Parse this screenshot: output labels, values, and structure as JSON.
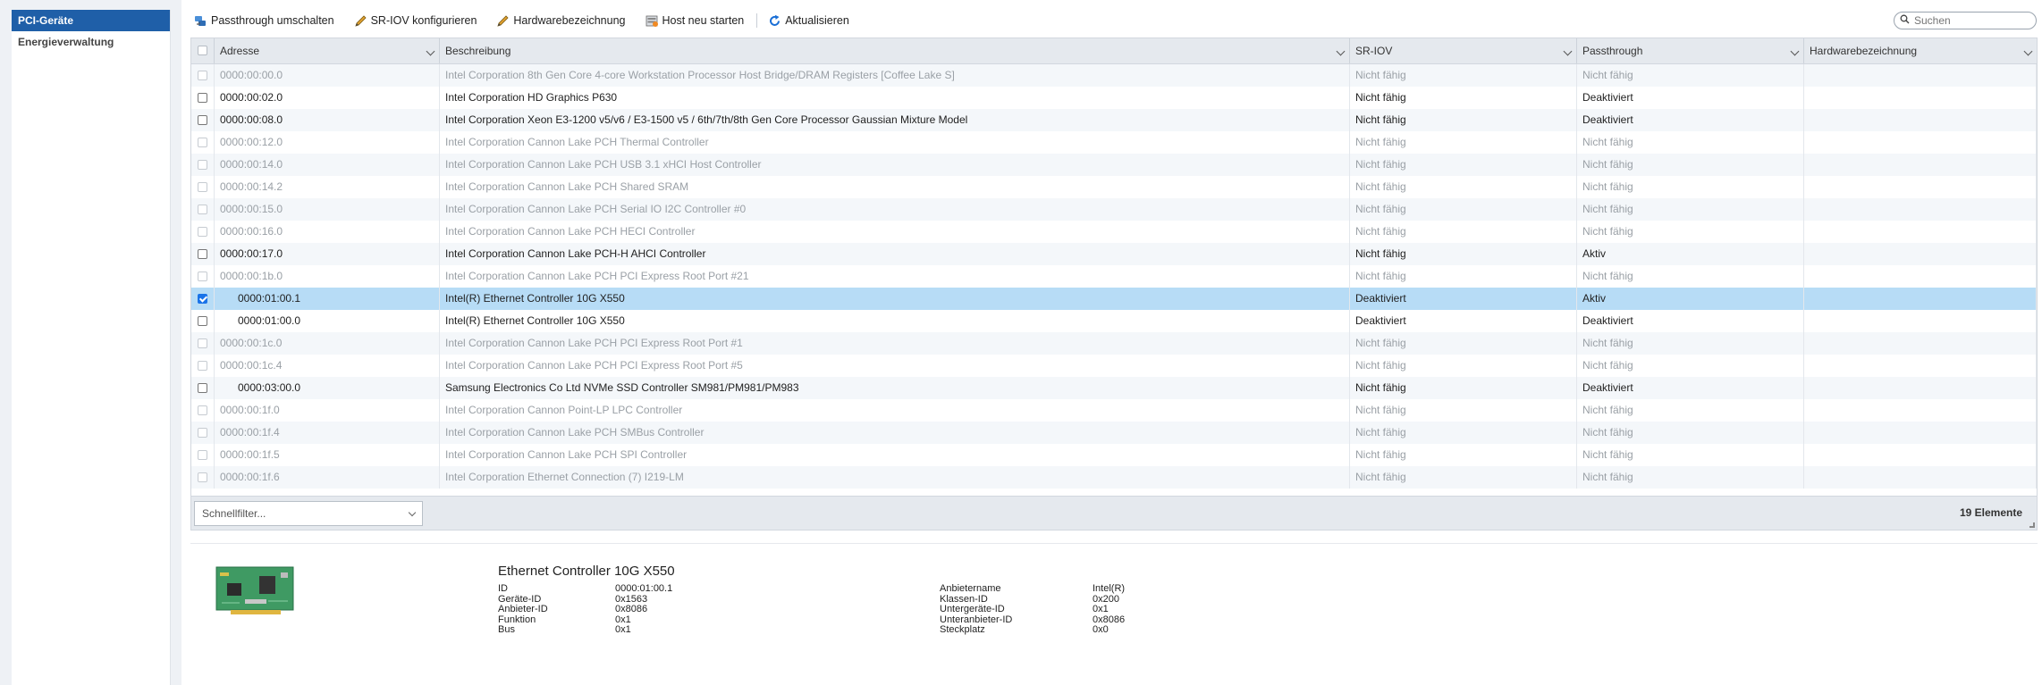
{
  "sidebar": {
    "items": [
      {
        "label": "PCI-Geräte",
        "active": true
      },
      {
        "label": "Energieverwaltung",
        "active": false
      }
    ]
  },
  "toolbar": {
    "passthrough": "Passthrough umschalten",
    "sriov": "SR-IOV konfigurieren",
    "hwlabel": "Hardwarebezeichnung",
    "restart": "Host neu starten",
    "refresh": "Aktualisieren",
    "search_placeholder": "Suchen"
  },
  "grid": {
    "columns": [
      "Adresse",
      "Beschreibung",
      "SR-IOV",
      "Passthrough",
      "Hardwarebezeichnung"
    ],
    "rows": [
      {
        "address": "0000:00:00.0",
        "description": "Intel Corporation 8th Gen Core 4-core Workstation Processor Host Bridge/DRAM Registers [Coffee Lake S]",
        "sriov": "Nicht fähig",
        "passthrough": "Nicht fähig",
        "hw": "",
        "enabled": false,
        "checked": false,
        "indent": false
      },
      {
        "address": "0000:00:02.0",
        "description": "Intel Corporation HD Graphics P630",
        "sriov": "Nicht fähig",
        "passthrough": "Deaktiviert",
        "hw": "",
        "enabled": true,
        "checked": false,
        "indent": false
      },
      {
        "address": "0000:00:08.0",
        "description": "Intel Corporation Xeon E3-1200 v5/v6 / E3-1500 v5 / 6th/7th/8th Gen Core Processor Gaussian Mixture Model",
        "sriov": "Nicht fähig",
        "passthrough": "Deaktiviert",
        "hw": "",
        "enabled": true,
        "checked": false,
        "indent": false
      },
      {
        "address": "0000:00:12.0",
        "description": "Intel Corporation Cannon Lake PCH Thermal Controller",
        "sriov": "Nicht fähig",
        "passthrough": "Nicht fähig",
        "hw": "",
        "enabled": false,
        "checked": false,
        "indent": false
      },
      {
        "address": "0000:00:14.0",
        "description": "Intel Corporation Cannon Lake PCH USB 3.1 xHCI Host Controller",
        "sriov": "Nicht fähig",
        "passthrough": "Nicht fähig",
        "hw": "",
        "enabled": false,
        "checked": false,
        "indent": false
      },
      {
        "address": "0000:00:14.2",
        "description": "Intel Corporation Cannon Lake PCH Shared SRAM",
        "sriov": "Nicht fähig",
        "passthrough": "Nicht fähig",
        "hw": "",
        "enabled": false,
        "checked": false,
        "indent": false
      },
      {
        "address": "0000:00:15.0",
        "description": "Intel Corporation Cannon Lake PCH Serial IO I2C Controller #0",
        "sriov": "Nicht fähig",
        "passthrough": "Nicht fähig",
        "hw": "",
        "enabled": false,
        "checked": false,
        "indent": false
      },
      {
        "address": "0000:00:16.0",
        "description": "Intel Corporation Cannon Lake PCH HECI Controller",
        "sriov": "Nicht fähig",
        "passthrough": "Nicht fähig",
        "hw": "",
        "enabled": false,
        "checked": false,
        "indent": false
      },
      {
        "address": "0000:00:17.0",
        "description": "Intel Corporation Cannon Lake PCH-H AHCI Controller",
        "sriov": "Nicht fähig",
        "passthrough": "Aktiv",
        "hw": "",
        "enabled": true,
        "checked": false,
        "indent": false
      },
      {
        "address": "0000:00:1b.0",
        "description": "Intel Corporation Cannon Lake PCH PCI Express Root Port #21",
        "sriov": "Nicht fähig",
        "passthrough": "Nicht fähig",
        "hw": "",
        "enabled": false,
        "checked": false,
        "indent": false
      },
      {
        "address": "0000:01:00.1",
        "description": "Intel(R) Ethernet Controller 10G X550",
        "sriov": "Deaktiviert",
        "passthrough": "Aktiv",
        "hw": "",
        "enabled": true,
        "checked": true,
        "indent": true
      },
      {
        "address": "0000:01:00.0",
        "description": "Intel(R) Ethernet Controller 10G X550",
        "sriov": "Deaktiviert",
        "passthrough": "Deaktiviert",
        "hw": "",
        "enabled": true,
        "checked": false,
        "indent": true
      },
      {
        "address": "0000:00:1c.0",
        "description": "Intel Corporation Cannon Lake PCH PCI Express Root Port #1",
        "sriov": "Nicht fähig",
        "passthrough": "Nicht fähig",
        "hw": "",
        "enabled": false,
        "checked": false,
        "indent": false
      },
      {
        "address": "0000:00:1c.4",
        "description": "Intel Corporation Cannon Lake PCH PCI Express Root Port #5",
        "sriov": "Nicht fähig",
        "passthrough": "Nicht fähig",
        "hw": "",
        "enabled": false,
        "checked": false,
        "indent": false
      },
      {
        "address": "0000:03:00.0",
        "description": "Samsung Electronics Co Ltd NVMe SSD Controller SM981/PM981/PM983",
        "sriov": "Nicht fähig",
        "passthrough": "Deaktiviert",
        "hw": "",
        "enabled": true,
        "checked": false,
        "indent": true
      },
      {
        "address": "0000:00:1f.0",
        "description": "Intel Corporation Cannon Point-LP LPC Controller",
        "sriov": "Nicht fähig",
        "passthrough": "Nicht fähig",
        "hw": "",
        "enabled": false,
        "checked": false,
        "indent": false
      },
      {
        "address": "0000:00:1f.4",
        "description": "Intel Corporation Cannon Lake PCH SMBus Controller",
        "sriov": "Nicht fähig",
        "passthrough": "Nicht fähig",
        "hw": "",
        "enabled": false,
        "checked": false,
        "indent": false
      },
      {
        "address": "0000:00:1f.5",
        "description": "Intel Corporation Cannon Lake PCH SPI Controller",
        "sriov": "Nicht fähig",
        "passthrough": "Nicht fähig",
        "hw": "",
        "enabled": false,
        "checked": false,
        "indent": false
      },
      {
        "address": "0000:00:1f.6",
        "description": "Intel Corporation Ethernet Connection (7) I219-LM",
        "sriov": "Nicht fähig",
        "passthrough": "Nicht fähig",
        "hw": "",
        "enabled": false,
        "checked": false,
        "indent": false
      }
    ],
    "quickfilter_placeholder": "Schnellfilter...",
    "count_label": "19 Elemente"
  },
  "details": {
    "title": "Ethernet Controller 10G X550",
    "left": [
      {
        "label": "ID",
        "value": "0000:01:00.1"
      },
      {
        "label": "Geräte-ID",
        "value": "0x1563"
      },
      {
        "label": "Anbieter-ID",
        "value": "0x8086"
      },
      {
        "label": "Funktion",
        "value": "0x1"
      },
      {
        "label": "Bus",
        "value": "0x1"
      }
    ],
    "right": [
      {
        "label": "Anbietername",
        "value": "Intel(R)"
      },
      {
        "label": "Klassen-ID",
        "value": "0x200"
      },
      {
        "label": "Untergeräte-ID",
        "value": "0x1"
      },
      {
        "label": "Unteranbieter-ID",
        "value": "0x8086"
      },
      {
        "label": "Steckplatz",
        "value": "0x0"
      }
    ]
  },
  "colors": {
    "accent": "#1f5fa8",
    "selected_row": "#b7dcf6",
    "checkbox_checked": "#1a73e8",
    "disabled_text": "#9aa0a6"
  },
  "icons": {
    "passthrough": "passthrough-icon",
    "sriov": "pencil-icon",
    "hwlabel": "pencil-icon",
    "restart": "restart-host-icon",
    "refresh": "refresh-icon",
    "search": "search-icon",
    "device": "pci-card-icon"
  }
}
